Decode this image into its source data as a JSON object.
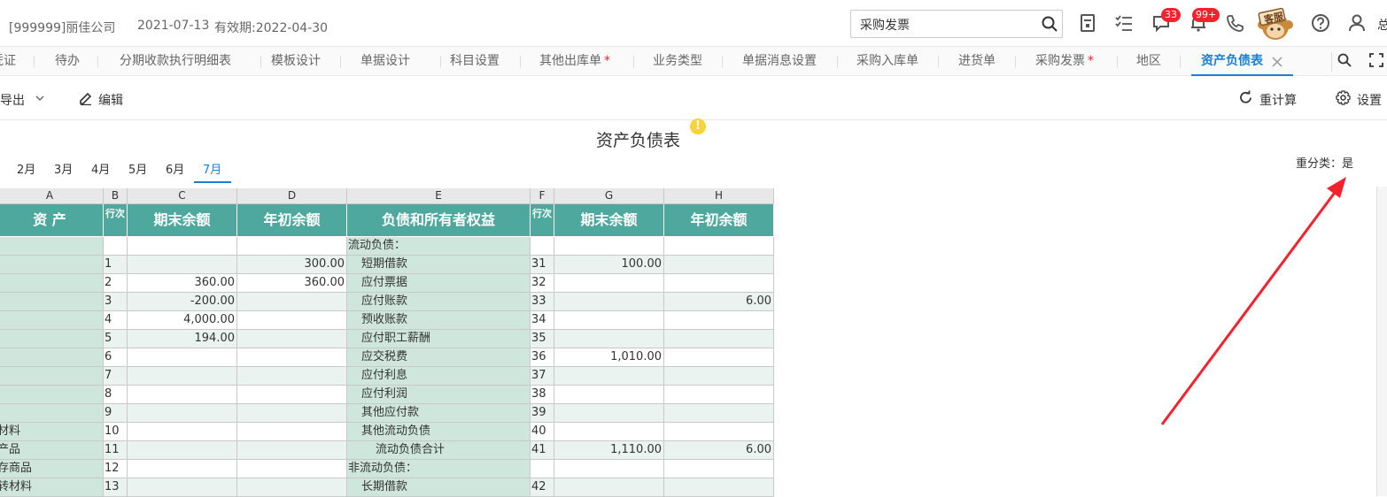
{
  "top": {
    "company": "[999999]丽佳公司",
    "date": "2021-07-13",
    "validity": "有效期:2022-04-30",
    "search_value": "采购发票",
    "msg_badge": "33",
    "notice_badge": "99+",
    "kefu_label": "客服",
    "user_initial": "总"
  },
  "tabs": [
    {
      "label": "凭证",
      "star": false,
      "active": false
    },
    {
      "label": "待办",
      "star": false,
      "active": false
    },
    {
      "label": "分期收款执行明细表",
      "star": false,
      "active": false
    },
    {
      "label": "模板设计",
      "star": false,
      "active": false
    },
    {
      "label": "单据设计",
      "star": false,
      "active": false
    },
    {
      "label": "科目设置",
      "star": false,
      "active": false
    },
    {
      "label": "其他出库单",
      "star": true,
      "active": false
    },
    {
      "label": "业务类型",
      "star": false,
      "active": false
    },
    {
      "label": "单据消息设置",
      "star": false,
      "active": false
    },
    {
      "label": "采购入库单",
      "star": false,
      "active": false
    },
    {
      "label": "进货单",
      "star": false,
      "active": false
    },
    {
      "label": "采购发票",
      "star": true,
      "active": false
    },
    {
      "label": "地区",
      "star": false,
      "active": false
    },
    {
      "label": "资产负债表",
      "star": false,
      "active": true
    }
  ],
  "tab_star_glyph": "*",
  "toolbar": {
    "export_label": "导出",
    "edit_label": "编辑",
    "recalc_label": "重计算",
    "settings_label": "设置"
  },
  "report": {
    "title": "资产负债表",
    "reclass": "重分类：是",
    "months": [
      "2月",
      "3月",
      "4月",
      "5月",
      "6月",
      "7月"
    ],
    "active_month": "7月"
  },
  "columns": {
    "letters": [
      "A",
      "B",
      "C",
      "D",
      "E",
      "F",
      "G",
      "H"
    ],
    "headers": [
      "资  产",
      "行次",
      "期末余额",
      "年初余额",
      "负债和所有者权益",
      "行次",
      "期末余额",
      "年初余额"
    ]
  },
  "rows": [
    {
      "a": "",
      "b": "",
      "c": "",
      "d": "",
      "e": "流动负债：",
      "f": "",
      "g": "",
      "h": ""
    },
    {
      "a": "",
      "b": "1",
      "c": "",
      "d": "300.00",
      "e": "短期借款",
      "f": "31",
      "g": "100.00",
      "h": ""
    },
    {
      "a": "",
      "b": "2",
      "c": "360.00",
      "d": "360.00",
      "e": "应付票据",
      "f": "32",
      "g": "",
      "h": ""
    },
    {
      "a": "",
      "b": "3",
      "c": "-200.00",
      "d": "",
      "e": "应付账款",
      "f": "33",
      "g": "",
      "h": "6.00"
    },
    {
      "a": "",
      "b": "4",
      "c": "4,000.00",
      "d": "",
      "e": "预收账款",
      "f": "34",
      "g": "",
      "h": ""
    },
    {
      "a": "",
      "b": "5",
      "c": "194.00",
      "d": "",
      "e": "应付职工薪酬",
      "f": "35",
      "g": "",
      "h": ""
    },
    {
      "a": "",
      "b": "6",
      "c": "",
      "d": "",
      "e": "应交税费",
      "f": "36",
      "g": "1,010.00",
      "h": ""
    },
    {
      "a": "",
      "b": "7",
      "c": "",
      "d": "",
      "e": "应付利息",
      "f": "37",
      "g": "",
      "h": ""
    },
    {
      "a": "",
      "b": "8",
      "c": "",
      "d": "",
      "e": "应付利润",
      "f": "38",
      "g": "",
      "h": ""
    },
    {
      "a": "",
      "b": "9",
      "c": "",
      "d": "",
      "e": "其他应付款",
      "f": "39",
      "g": "",
      "h": ""
    },
    {
      "a": "材料",
      "b": "10",
      "c": "",
      "d": "",
      "e": "其他流动负债",
      "f": "40",
      "g": "",
      "h": ""
    },
    {
      "a": "产品",
      "b": "11",
      "c": "",
      "d": "",
      "e": "流动负债合计",
      "f": "41",
      "g": "1,110.00",
      "h": "6.00"
    },
    {
      "a": "存商品",
      "b": "12",
      "c": "",
      "d": "",
      "e": "非流动负债：",
      "f": "",
      "g": "",
      "h": ""
    },
    {
      "a": "转材料",
      "b": "13",
      "c": "",
      "d": "",
      "e": "长期借款",
      "f": "42",
      "g": "",
      "h": ""
    }
  ],
  "colors": {
    "header_teal": "#4fa89e",
    "label_green": "#cfe6dd",
    "row_alt": "#eaf3f0",
    "accent_blue": "#1a7fd4",
    "arrow_red": "#f5222d"
  }
}
